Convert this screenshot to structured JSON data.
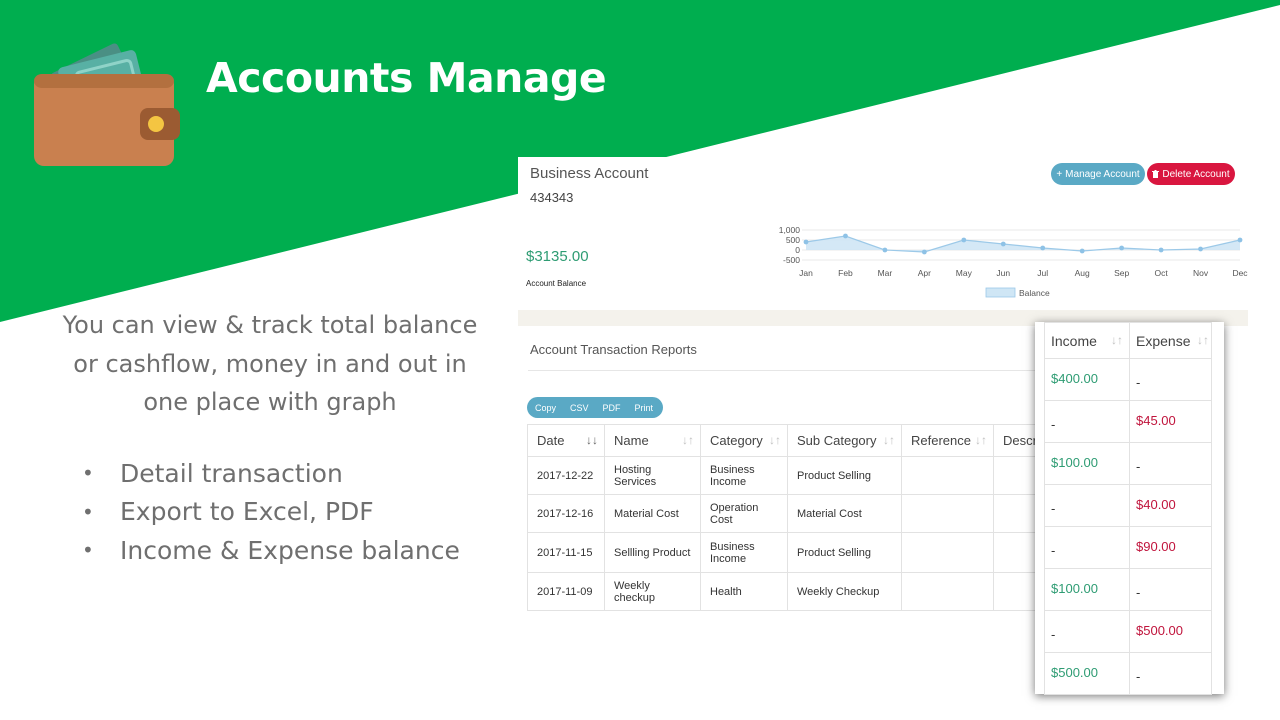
{
  "headline": "Accounts Manage",
  "intro": "You can view & track total balance or cashflow, money in and out in one place with graph",
  "bullets": [
    "Detail transaction",
    "Export to Excel, PDF",
    "Income & Expense balance"
  ],
  "colors": {
    "brand_green": "#00ae4f",
    "income": "#2e9c73",
    "expense": "#c0143c",
    "button_blue": "#5aa9c5",
    "button_red": "#d9163f"
  },
  "account": {
    "title": "Business Account",
    "number": "434343",
    "manage_label": "Manage Account",
    "delete_label": "Delete Account",
    "balance": "$3135.00",
    "balance_label": "Account Balance"
  },
  "chart_data": {
    "type": "area",
    "categories": [
      "Jan",
      "Feb",
      "Mar",
      "Apr",
      "May",
      "Jun",
      "Jul",
      "Aug",
      "Sep",
      "Oct",
      "Nov",
      "Dec"
    ],
    "series": [
      {
        "name": "Balance",
        "values": [
          400,
          700,
          0,
          -100,
          500,
          300,
          100,
          -50,
          100,
          0,
          50,
          500
        ]
      }
    ],
    "yticks": [
      "1,000",
      "500",
      "0",
      "-500"
    ],
    "ylim": [
      -500,
      1000
    ],
    "grid": true,
    "legend": "bottom"
  },
  "report": {
    "title": "Account Transaction Reports",
    "export_buttons": [
      "Copy",
      "CSV",
      "PDF",
      "Print"
    ],
    "columns": [
      "Date",
      "Name",
      "Category",
      "Sub Category",
      "Reference",
      "Descri"
    ],
    "rows": [
      {
        "date": "2017-12-22",
        "name": "Hosting Services",
        "category": "Business Income",
        "sub": "Product Selling"
      },
      {
        "date": "2017-12-16",
        "name": "Material Cost",
        "category": "Operation Cost",
        "sub": "Material Cost"
      },
      {
        "date": "2017-11-15",
        "name": "Sellling Product",
        "category": "Business Income",
        "sub": "Product Selling"
      },
      {
        "date": "2017-11-09",
        "name": "Weekly checkup",
        "category": "Health",
        "sub": "Weekly Checkup"
      }
    ]
  },
  "zoom": {
    "columns": [
      "Income",
      "Expense"
    ],
    "rows": [
      {
        "income": "$400.00",
        "expense": "-"
      },
      {
        "income": "-",
        "expense": "$45.00"
      },
      {
        "income": "$100.00",
        "expense": "-"
      },
      {
        "income": "-",
        "expense": "$40.00"
      },
      {
        "income": "-",
        "expense": "$90.00"
      },
      {
        "income": "$100.00",
        "expense": "-"
      },
      {
        "income": "-",
        "expense": "$500.00"
      },
      {
        "income": "$500.00",
        "expense": "-"
      }
    ]
  }
}
